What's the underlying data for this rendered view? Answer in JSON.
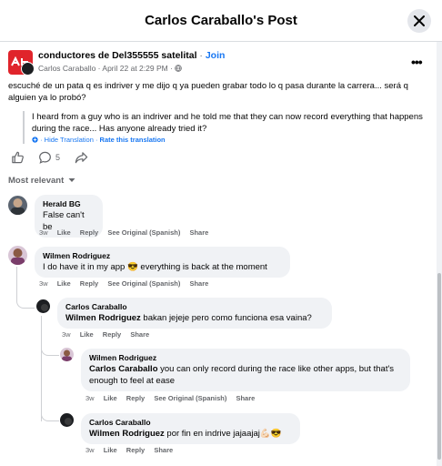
{
  "header": {
    "title": "Carlos Caraballo's Post"
  },
  "post": {
    "group_name": "conductores de Del355555 satelital",
    "separator": " · ",
    "join_label": "Join",
    "author": "Carlos Caraballo",
    "meta_sep": " · ",
    "date": "April 22 at 2:29 PM",
    "meta_sep2": " · ",
    "privacy_icon": "globe-icon",
    "text": "escuché de un pata q es indriver y me dijo q ya pueden grabar todo lo q pasa durante la carrera... será q alguien ya lo probó?",
    "translation": "I heard from a guy who is an indriver and he told me that they can now record everything that happens during the race... Has anyone already tried it?",
    "hide_translation": "· Hide Translation",
    "link_sep": " · ",
    "rate_translation": "Rate this translation",
    "comment_count": "5"
  },
  "sort": {
    "label": "Most relevant"
  },
  "actions": {
    "like": "Like",
    "reply": "Reply",
    "see_original": "See Original (Spanish)",
    "share": "Share"
  },
  "comments": [
    {
      "name": "Herald BG",
      "text": "False can't be",
      "time": "3w",
      "see_original": true
    },
    {
      "name": "Wilmen Rodriguez",
      "text": "I do have it in my app 😎 everything is back at the moment",
      "time": "3w",
      "see_original": true
    },
    {
      "name": "Carlos Caraballo",
      "mention": "Wilmen Rodriguez",
      "text": " bakan jejeje pero como funciona esa vaina?",
      "time": "3w",
      "see_original": false
    },
    {
      "name": "Wilmen Rodriguez",
      "mention": "Carlos Caraballo",
      "text": " you can only record during the race like other apps, but that's enough to feel at ease",
      "time": "3w",
      "see_original": true
    },
    {
      "name": "Carlos Caraballo",
      "mention": "Wilmen Rodriguez",
      "text": " por fin en indrive jajaajaj💪🏻😎",
      "time": "3w",
      "see_original": false
    }
  ],
  "colors": {
    "accent": "#1877f2",
    "bubble": "#f0f2f5",
    "muted": "#65676b"
  }
}
